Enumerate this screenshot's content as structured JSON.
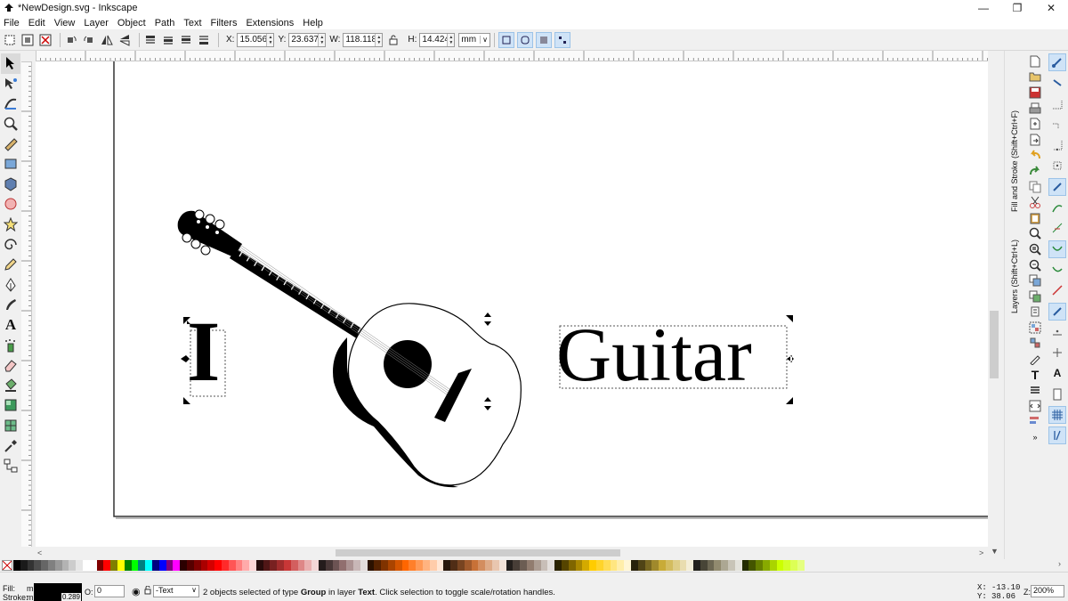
{
  "window": {
    "title": "*NewDesign.svg - Inkscape",
    "controls": [
      "minimize",
      "restore",
      "close"
    ]
  },
  "menu": [
    "File",
    "Edit",
    "View",
    "Layer",
    "Object",
    "Path",
    "Text",
    "Filters",
    "Extensions",
    "Help"
  ],
  "tool_controls": {
    "x_label": "X:",
    "x_value": "15.056",
    "y_label": "Y:",
    "y_value": "23.637",
    "w_label": "W:",
    "w_value": "118.118",
    "h_label": "H:",
    "h_value": "14.424",
    "unit": "mm"
  },
  "canvas": {
    "text_left": "I",
    "text_right": "Guitar"
  },
  "dock_tabs": [
    "Fill and Stroke (Shift+Ctrl+F)",
    "Layers (Shift+Ctrl+L)"
  ],
  "status": {
    "fill_label": "Fill:",
    "fill_value": "m",
    "stroke_label": "Stroke:",
    "stroke_value": "m",
    "stroke_width": "0.289",
    "opacity_label": "O:",
    "opacity_value": "0",
    "layer_name": "-Text",
    "message_prefix": "2 objects selected of type ",
    "message_type": "Group",
    "message_mid": " in layer ",
    "message_layer": "Text",
    "message_suffix": ". Click selection to toggle scale/rotation handles.",
    "x_label": "X:",
    "x_coord": "-13.10",
    "y_label": "Y:",
    "y_coord": "38.06",
    "zoom_label": "Z:",
    "zoom_value": "200%"
  },
  "colors": {
    "selection_dash": "#555555",
    "toggle_on": "#cfe3f7"
  }
}
